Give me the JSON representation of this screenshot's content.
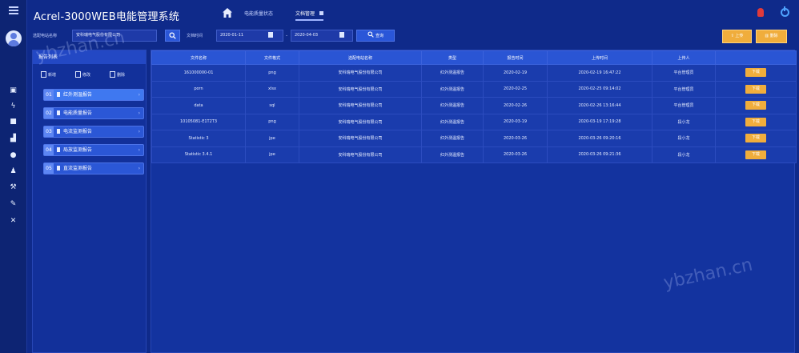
{
  "app": {
    "title": "Acrel-3000WEB电能管理系统"
  },
  "tabs": [
    {
      "label": "电能质量状态"
    },
    {
      "label": "文档管理"
    }
  ],
  "filters": {
    "org_label": "选配电站名称",
    "org_value": "安科瑞电气股份有限公司",
    "date_label": "文档时间",
    "date_start": "2020-01-11",
    "date_end": "2020-04-03",
    "search_label": "查询"
  },
  "actions": {
    "upload_label": "上传",
    "delete_label": "删除"
  },
  "tree": {
    "header": "报告列表",
    "add_label": "新增",
    "edit_label": "修改",
    "delete_label": "删除",
    "items": [
      {
        "num": "01",
        "label": "红外测温报告"
      },
      {
        "num": "02",
        "label": "电能质量报告"
      },
      {
        "num": "03",
        "label": "电流监测报告"
      },
      {
        "num": "04",
        "label": "局放监测报告"
      },
      {
        "num": "05",
        "label": "直流监测报告"
      }
    ]
  },
  "table": {
    "columns": [
      "文件名称",
      "文件格式",
      "选配电站名称",
      "类型",
      "报告时间",
      "上传时间",
      "上传人",
      ""
    ],
    "rows": [
      [
        "161000000-01",
        "png",
        "安科瑞电气股份有限公司",
        "红外测温报告",
        "2020-02-19",
        "2020-02-19 16:47:22",
        "平台管理员",
        "下载"
      ],
      [
        "porn",
        "xlsx",
        "安科瑞电气股份有限公司",
        "红外测温报告",
        "2020-02-25",
        "2020-02-25 09:14:02",
        "平台管理员",
        "下载"
      ],
      [
        "data",
        "sql",
        "安科瑞电气股份有限公司",
        "红外测温报告",
        "2020-02-26",
        "2020-02-26 13:16:44",
        "平台管理员",
        "下载"
      ],
      [
        "10105081-E1T2T3",
        "png",
        "安科瑞电气股份有限公司",
        "红外测温报告",
        "2020-03-19",
        "2020-03-19 17:19:28",
        "段小龙",
        "下载"
      ],
      [
        "Statistic 3",
        "jpe",
        "安科瑞电气股份有限公司",
        "红外测温报告",
        "2020-03-26",
        "2020-03-26 09:20:16",
        "段小龙",
        "下载"
      ],
      [
        "Statistic 3.4.1",
        "jpe",
        "安科瑞电气股份有限公司",
        "红外测温报告",
        "2020-03-26",
        "2020-03-26 09:21:36",
        "段小龙",
        "下载"
      ]
    ]
  },
  "watermark": "ybzhan.cn",
  "colors": {
    "accent": "#2a55d4",
    "warning": "#f0ad3c",
    "background": "#0f2a8a"
  }
}
